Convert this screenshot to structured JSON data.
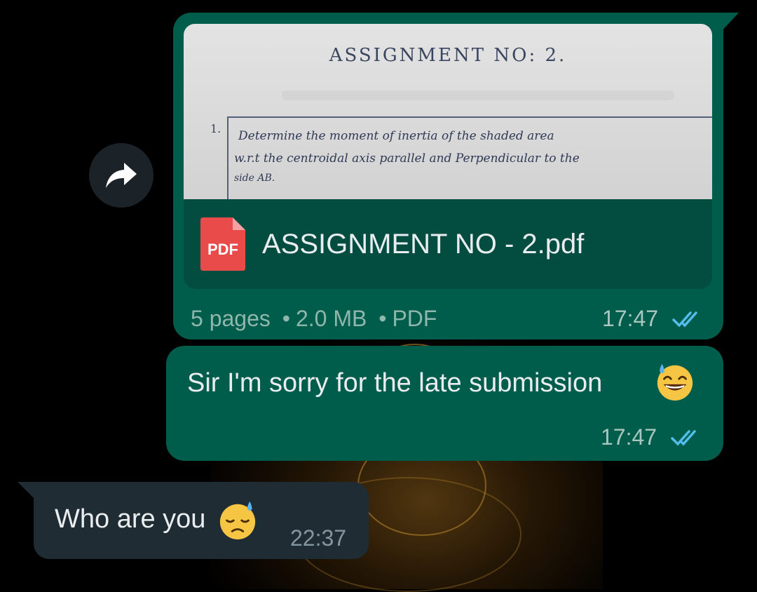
{
  "document_message": {
    "preview": {
      "title": "ASSIGNMENT NO: 2.",
      "question_number": "1.",
      "lines": [
        "Determine the moment of inertia of the shaded area",
        "w.r.t the centroidal axis parallel and Perpendicular to the",
        "side AB."
      ]
    },
    "pdf_icon_label": "PDF",
    "file_name": "ASSIGNMENT NO - 2.pdf",
    "pages": "5 pages",
    "size": "2.0 MB",
    "type": "PDF",
    "separator": "•",
    "time": "17:47",
    "status_icon": "double-check-read-icon"
  },
  "text_message": {
    "text": "Sir I'm sorry for the late submission",
    "emoji": "grinning-sweat-emoji",
    "time": "17:47",
    "status_icon": "double-check-read-icon"
  },
  "incoming_message": {
    "text": "Who are you",
    "emoji": "downcast-sweat-emoji",
    "time": "22:37"
  },
  "forward_icon": "forward-arrow-icon",
  "colors": {
    "outgoing_bubble": "#005c4b",
    "incoming_bubble": "#1f2c34",
    "read_ticks": "#53bdeb",
    "pdf_red": "#e94b4b"
  }
}
